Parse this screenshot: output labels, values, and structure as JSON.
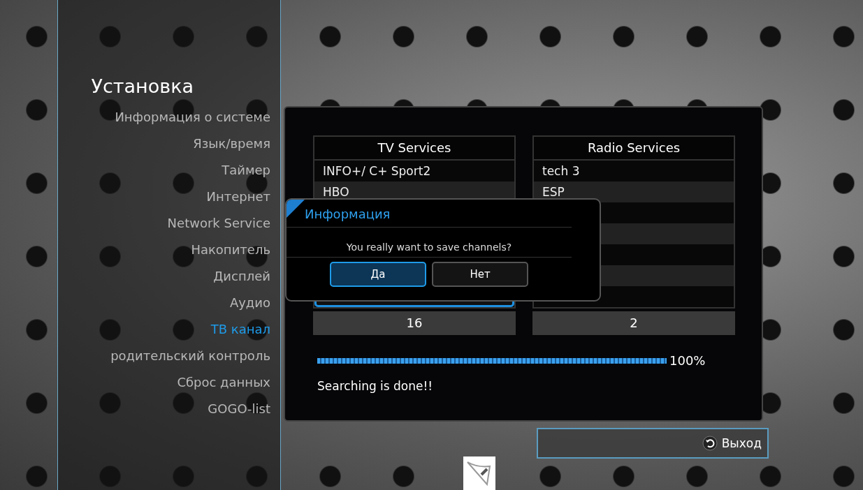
{
  "sidebar": {
    "title": "Установка",
    "items": [
      {
        "label": "Информация о системе",
        "selected": false
      },
      {
        "label": "Язык/время",
        "selected": false
      },
      {
        "label": "Таймер",
        "selected": false
      },
      {
        "label": "Интернет",
        "selected": false
      },
      {
        "label": "Network Service",
        "selected": false
      },
      {
        "label": "Накопитель",
        "selected": false
      },
      {
        "label": "Дисплей",
        "selected": false
      },
      {
        "label": "Аудио",
        "selected": false
      },
      {
        "label": "ТВ канал",
        "selected": true
      },
      {
        "label": "родительский контроль",
        "selected": false
      },
      {
        "label": "Сброс данных",
        "selected": false
      },
      {
        "label": "GOGO-list",
        "selected": false
      }
    ]
  },
  "tv_services": {
    "title": "TV Services",
    "rows": [
      {
        "label": "INFO+/ C+ Sport2",
        "selected": false
      },
      {
        "label": "HBO",
        "selected": false
      },
      {
        "selected": true
      }
    ],
    "count": "16"
  },
  "radio_services": {
    "title": "Radio Services",
    "rows": [
      {
        "label": "tech 3"
      },
      {
        "label": "ESP"
      }
    ],
    "count": "2"
  },
  "progress": {
    "level": 1,
    "reading": "100%"
  },
  "status": "Searching is done!!",
  "dialog": {
    "title": "Информация",
    "message": "You really want to save channels?",
    "buttons": [
      {
        "label": "Да",
        "selected": true
      },
      {
        "label": "Нет",
        "selected": false
      }
    ]
  },
  "exit_button": {
    "label": "Выход"
  }
}
